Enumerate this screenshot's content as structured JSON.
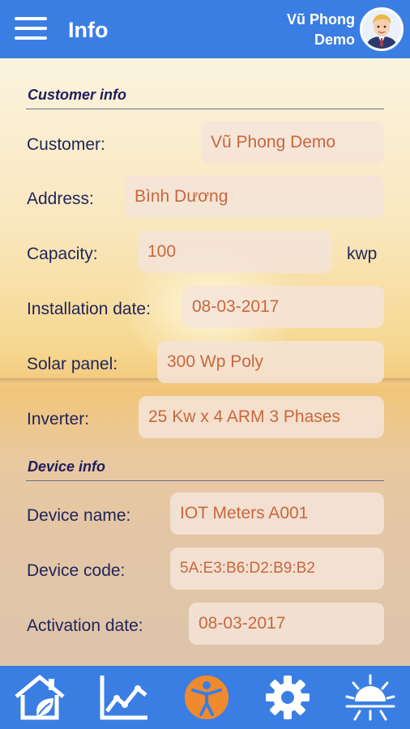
{
  "header": {
    "menu_icon": "hamburger-menu-icon",
    "title": "Info",
    "user_line1": "Vũ Phong",
    "user_line2": "Demo"
  },
  "customer_info": {
    "section_title": "Customer info",
    "customer_label": "Customer:",
    "customer_value": "Vũ Phong Demo",
    "address_label": "Address:",
    "address_value": "Bình Dương",
    "capacity_label": "Capacity:",
    "capacity_value": "100",
    "capacity_unit": "kwp",
    "installation_label": "Installation date:",
    "installation_value": "08-03-2017",
    "panel_label": "Solar panel:",
    "panel_value": "300 Wp Poly",
    "inverter_label": "Inverter:",
    "inverter_value": "25 Kw x 4 ARM 3 Phases"
  },
  "device_info": {
    "section_title": "Device info",
    "name_label": "Device name:",
    "name_value": "IOT Meters A001",
    "code_label": "Device code:",
    "code_value": "5A:E3:B6:D2:B9:B2",
    "activation_label": "Activation date:",
    "activation_value": "08-03-2017"
  },
  "nav": {
    "items": [
      "home-eco-icon",
      "chart-line-icon",
      "person-icon",
      "gear-icon",
      "sun-icon"
    ],
    "active_index": 2,
    "active_color": "#f08a2e"
  },
  "colors": {
    "header_bg": "#3b7ee3",
    "label": "#1f2457",
    "value": "#c8673e"
  }
}
